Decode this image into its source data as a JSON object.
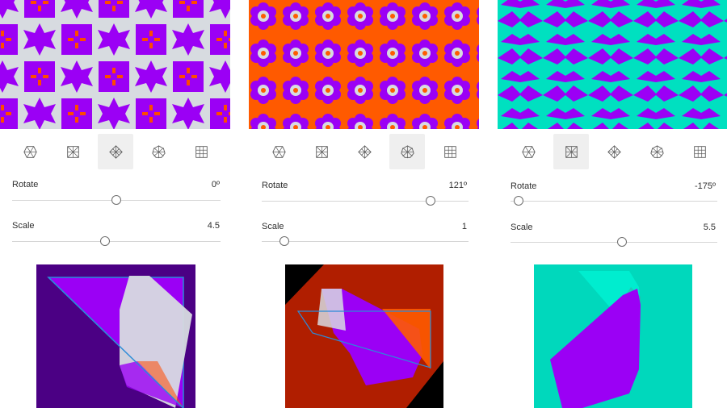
{
  "panels": [
    {
      "rotate": {
        "label": "Rotate",
        "value": "0º",
        "fraction": 0.5
      },
      "scale": {
        "label": "Scale",
        "value": "4.5",
        "fraction": 0.45
      },
      "selected_symmetry": 2
    },
    {
      "rotate": {
        "label": "Rotate",
        "value": "121º",
        "fraction": 0.82
      },
      "scale": {
        "label": "Scale",
        "value": "1",
        "fraction": 0.1
      },
      "selected_symmetry": 3
    },
    {
      "rotate": {
        "label": "Rotate",
        "value": "-175º",
        "fraction": 0.02
      },
      "scale": {
        "label": "Scale",
        "value": "5.5",
        "fraction": 0.55
      },
      "selected_symmetry": 1
    }
  ],
  "symmetry_icons": [
    "hexagon-symmetry-icon",
    "square-symmetry-icon",
    "diamond-symmetry-icon",
    "radial-symmetry-icon",
    "grid-symmetry-icon"
  ],
  "colors": {
    "purple": "#9b00f5",
    "light_gray": "#d7dbe0",
    "orange": "#ff5a00",
    "teal": "#00e0c0",
    "dark_purple": "#4b0084",
    "dark_red": "#b01e00"
  }
}
